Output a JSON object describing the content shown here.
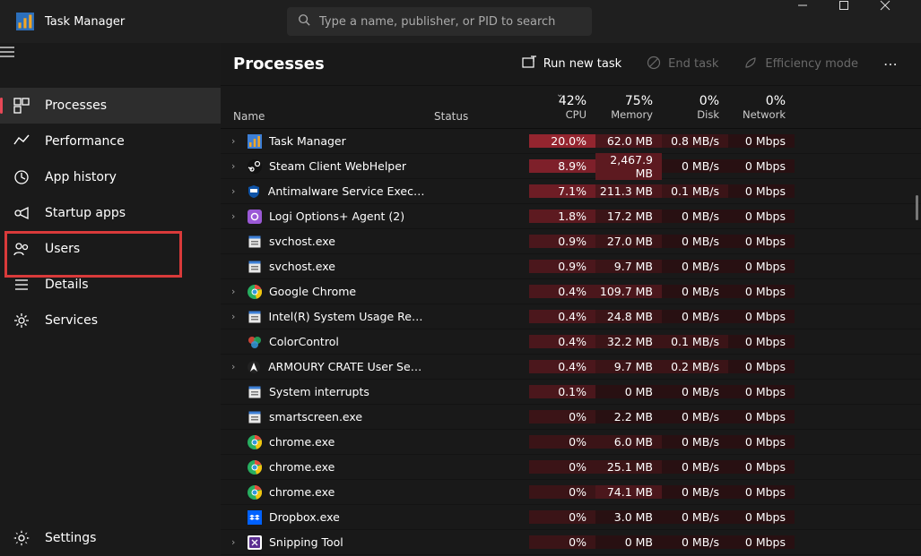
{
  "window": {
    "title": "Task Manager"
  },
  "search": {
    "placeholder": "Type a name, publisher, or PID to search"
  },
  "sidebar": {
    "items": [
      {
        "icon": "processes",
        "label": "Processes"
      },
      {
        "icon": "performance",
        "label": "Performance"
      },
      {
        "icon": "history",
        "label": "App history"
      },
      {
        "icon": "startup",
        "label": "Startup apps"
      },
      {
        "icon": "users",
        "label": "Users"
      },
      {
        "icon": "details",
        "label": "Details"
      },
      {
        "icon": "services",
        "label": "Services"
      }
    ],
    "settings_label": "Settings"
  },
  "toolbar": {
    "heading": "Processes",
    "run_label": "Run new task",
    "end_label": "End task",
    "eff_label": "Efficiency mode"
  },
  "columns": {
    "name": "Name",
    "status": "Status",
    "cpu": {
      "pct": "42%",
      "label": "CPU"
    },
    "memory": {
      "pct": "75%",
      "label": "Memory"
    },
    "disk": {
      "pct": "0%",
      "label": "Disk"
    },
    "network": {
      "pct": "0%",
      "label": "Network"
    }
  },
  "rows": [
    {
      "icon": "tm",
      "name": "Task Manager",
      "cpu": "20.0%",
      "mem": "62.0 MB",
      "disk": "0.8 MB/s",
      "net": "0 Mbps",
      "expand": true,
      "cpuHeat": 6,
      "memHeat": 2,
      "diskHeat": 1,
      "netHeat": 0
    },
    {
      "icon": "steam",
      "name": "Steam Client WebHelper",
      "cpu": "8.9%",
      "mem": "2,467.9 MB",
      "disk": "0 MB/s",
      "net": "0 Mbps",
      "expand": true,
      "cpuHeat": 5,
      "memHeat": 3,
      "diskHeat": 0,
      "netHeat": 0
    },
    {
      "icon": "shield",
      "name": "Antimalware Service Executable",
      "cpu": "7.1%",
      "mem": "211.3 MB",
      "disk": "0.1 MB/s",
      "net": "0 Mbps",
      "expand": true,
      "cpuHeat": 4,
      "memHeat": 2,
      "diskHeat": 1,
      "netHeat": 0
    },
    {
      "icon": "logi",
      "name": "Logi Options+ Agent (2)",
      "cpu": "1.8%",
      "mem": "17.2 MB",
      "disk": "0 MB/s",
      "net": "0 Mbps",
      "expand": true,
      "cpuHeat": 3,
      "memHeat": 1,
      "diskHeat": 0,
      "netHeat": 0
    },
    {
      "icon": "exe",
      "name": "svchost.exe",
      "cpu": "0.9%",
      "mem": "27.0 MB",
      "disk": "0 MB/s",
      "net": "0 Mbps",
      "expand": false,
      "cpuHeat": 2,
      "memHeat": 1,
      "diskHeat": 0,
      "netHeat": 0
    },
    {
      "icon": "exe",
      "name": "svchost.exe",
      "cpu": "0.9%",
      "mem": "9.7 MB",
      "disk": "0 MB/s",
      "net": "0 Mbps",
      "expand": false,
      "cpuHeat": 2,
      "memHeat": 1,
      "diskHeat": 0,
      "netHeat": 0
    },
    {
      "icon": "chrome",
      "name": "Google Chrome",
      "cpu": "0.4%",
      "mem": "109.7 MB",
      "disk": "0 MB/s",
      "net": "0 Mbps",
      "expand": true,
      "cpuHeat": 2,
      "memHeat": 2,
      "diskHeat": 0,
      "netHeat": 0
    },
    {
      "icon": "exe",
      "name": "Intel(R) System Usage Report",
      "cpu": "0.4%",
      "mem": "24.8 MB",
      "disk": "0 MB/s",
      "net": "0 Mbps",
      "expand": true,
      "cpuHeat": 2,
      "memHeat": 1,
      "diskHeat": 0,
      "netHeat": 0
    },
    {
      "icon": "color",
      "name": "ColorControl",
      "cpu": "0.4%",
      "mem": "32.2 MB",
      "disk": "0.1 MB/s",
      "net": "0 Mbps",
      "expand": false,
      "cpuHeat": 2,
      "memHeat": 1,
      "diskHeat": 1,
      "netHeat": 0
    },
    {
      "icon": "armoury",
      "name": "ARMOURY CRATE User Sessio...",
      "cpu": "0.4%",
      "mem": "9.7 MB",
      "disk": "0.2 MB/s",
      "net": "0 Mbps",
      "expand": true,
      "cpuHeat": 2,
      "memHeat": 1,
      "diskHeat": 1,
      "netHeat": 0
    },
    {
      "icon": "sys",
      "name": "System interrupts",
      "cpu": "0.1%",
      "mem": "0 MB",
      "disk": "0 MB/s",
      "net": "0 Mbps",
      "expand": false,
      "cpuHeat": 2,
      "memHeat": 0,
      "diskHeat": 0,
      "netHeat": 0
    },
    {
      "icon": "exe",
      "name": "smartscreen.exe",
      "cpu": "0%",
      "mem": "2.2 MB",
      "disk": "0 MB/s",
      "net": "0 Mbps",
      "expand": false,
      "cpuHeat": 1,
      "memHeat": 0,
      "diskHeat": 0,
      "netHeat": 0
    },
    {
      "icon": "chrome",
      "name": "chrome.exe",
      "cpu": "0%",
      "mem": "6.0 MB",
      "disk": "0 MB/s",
      "net": "0 Mbps",
      "expand": false,
      "cpuHeat": 1,
      "memHeat": 1,
      "diskHeat": 0,
      "netHeat": 0
    },
    {
      "icon": "chrome",
      "name": "chrome.exe",
      "cpu": "0%",
      "mem": "25.1 MB",
      "disk": "0 MB/s",
      "net": "0 Mbps",
      "expand": false,
      "cpuHeat": 1,
      "memHeat": 1,
      "diskHeat": 0,
      "netHeat": 0
    },
    {
      "icon": "chrome",
      "name": "chrome.exe",
      "cpu": "0%",
      "mem": "74.1 MB",
      "disk": "0 MB/s",
      "net": "0 Mbps",
      "expand": false,
      "cpuHeat": 1,
      "memHeat": 2,
      "diskHeat": 0,
      "netHeat": 0
    },
    {
      "icon": "dropbox",
      "name": "Dropbox.exe",
      "cpu": "0%",
      "mem": "3.0 MB",
      "disk": "0 MB/s",
      "net": "0 Mbps",
      "expand": false,
      "cpuHeat": 1,
      "memHeat": 0,
      "diskHeat": 0,
      "netHeat": 0
    },
    {
      "icon": "snip",
      "name": "Snipping Tool",
      "cpu": "0%",
      "mem": "0 MB",
      "disk": "0 MB/s",
      "net": "0 Mbps",
      "expand": true,
      "cpuHeat": 1,
      "memHeat": 0,
      "diskHeat": 0,
      "netHeat": 0
    }
  ],
  "icons": {
    "tm": {
      "bg": "#3d7fd6",
      "accent": "#f5a623"
    },
    "steam": {
      "bg": "#111",
      "fg": "#fff"
    },
    "shield": {
      "bg": "#0e53a7",
      "fg": "#fff"
    },
    "logi": {
      "bg": "#9b59d6",
      "fg": "#fff"
    },
    "exe": {
      "bg": "#e8e8e8",
      "fg": "#3d7fd6"
    },
    "chrome": {
      "c1": "#e74c3c",
      "c2": "#f1c40f",
      "c3": "#27ae60",
      "c4": "#3498db"
    },
    "color": {
      "c1": "#e74c3c",
      "c2": "#f1c40f",
      "c3": "#27ae60",
      "c4": "#3498db"
    },
    "armoury": {
      "bg": "#222",
      "fg": "#fff"
    },
    "sys": {
      "bg": "#e8e8e8",
      "fg": "#3d7fd6"
    },
    "dropbox": {
      "bg": "#0061ff",
      "fg": "#fff"
    },
    "snip": {
      "bg": "#5b2e91",
      "fg": "#fff"
    }
  }
}
